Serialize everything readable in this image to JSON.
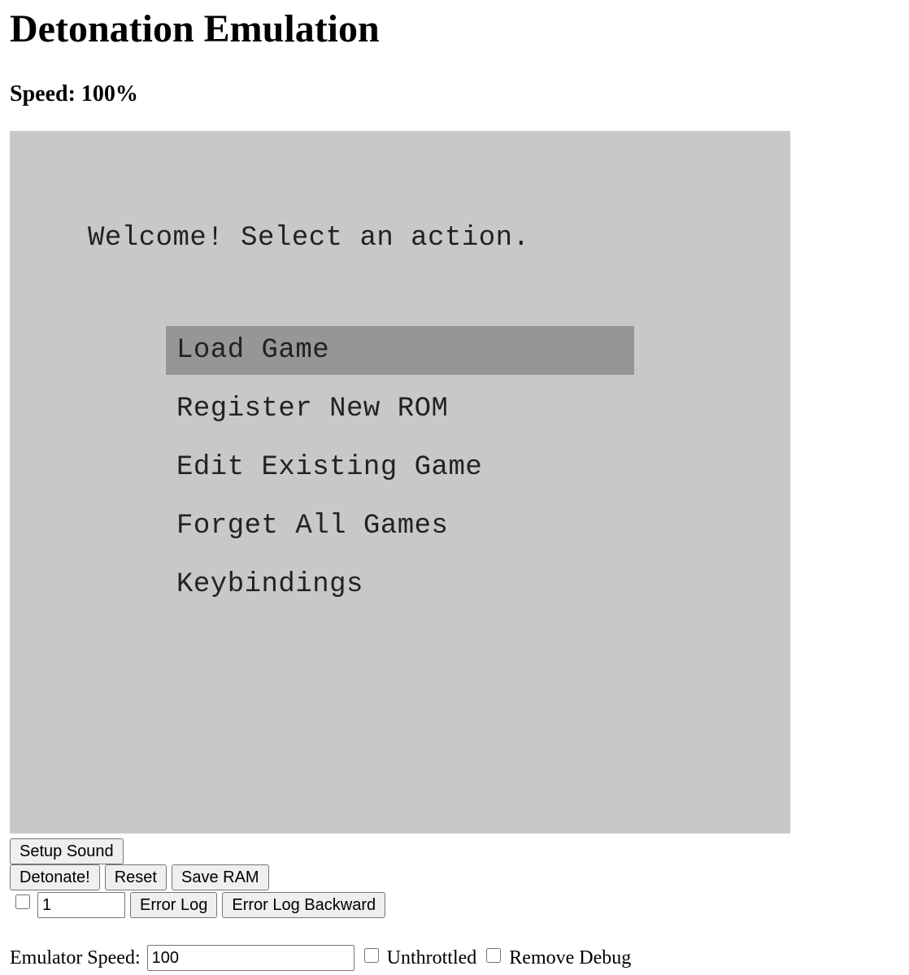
{
  "title": "Detonation Emulation",
  "speed_display": "Speed: 100%",
  "screen": {
    "welcome": "Welcome! Select an action.",
    "menu": [
      {
        "label": "Load Game",
        "selected": true
      },
      {
        "label": "Register New ROM",
        "selected": false
      },
      {
        "label": "Edit Existing Game",
        "selected": false
      },
      {
        "label": "Forget All Games",
        "selected": false
      },
      {
        "label": "Keybindings",
        "selected": false
      }
    ],
    "colors": {
      "background": "#c8c8c8",
      "selected": "#969696"
    }
  },
  "controls": {
    "setup_sound": "Setup Sound",
    "detonate": "Detonate!",
    "reset": "Reset",
    "save_ram": "Save RAM",
    "error_log_count": "1",
    "error_log": "Error Log",
    "error_log_backward": "Error Log Backward",
    "emulator_speed_label": "Emulator Speed:",
    "emulator_speed_value": "100",
    "unthrottled_label": "Unthrottled",
    "remove_debug_label": "Remove Debug"
  }
}
